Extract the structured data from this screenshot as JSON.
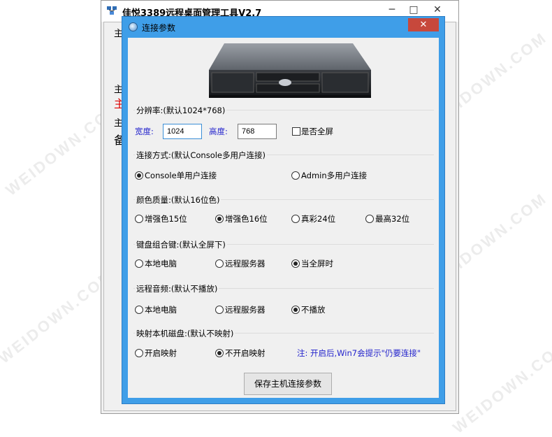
{
  "main_window": {
    "title": "佳悦3389远程桌面管理工具V2.7",
    "minimize": "─",
    "maximize": "□",
    "close": "✕",
    "bg_labels": [
      "主机",
      "主机",
      "主",
      "主机",
      "备"
    ]
  },
  "dialog": {
    "title": "连接参数",
    "close": "✕",
    "resolution": {
      "title": "分辨率:(默认1024*768)",
      "width_label": "宽度:",
      "width_value": "1024",
      "height_label": "高度:",
      "height_value": "768",
      "fullscreen_label": "是否全屏",
      "fullscreen_checked": false
    },
    "connection": {
      "title": "连接方式:(默认Console多用户连接)",
      "options": [
        "Console单用户连接",
        "Admin多用户连接"
      ],
      "selected": 0
    },
    "color": {
      "title": "颜色质量:(默认16位色)",
      "options": [
        "增强色15位",
        "增强色16位",
        "真彩24位",
        "最高32位"
      ],
      "selected": 1
    },
    "keyboard": {
      "title": "键盘组合键:(默认全屏下)",
      "options": [
        "本地电脑",
        "远程服务器",
        "当全屏时"
      ],
      "selected": 2
    },
    "audio": {
      "title": "远程音频:(默认不播放)",
      "options": [
        "本地电脑",
        "远程服务器",
        "不播放"
      ],
      "selected": 2
    },
    "drive": {
      "title": "映射本机磁盘:(默认不映射)",
      "options": [
        "开启映射",
        "不开启映射"
      ],
      "selected": 1,
      "note": "注: 开启后,Win7会提示\"仍要连接\""
    },
    "save_button": "保存主机连接参数"
  },
  "colors": {
    "dialog_frame": "#3f9ee8",
    "close_button": "#c7483c",
    "label_blue": "#2222cc"
  }
}
